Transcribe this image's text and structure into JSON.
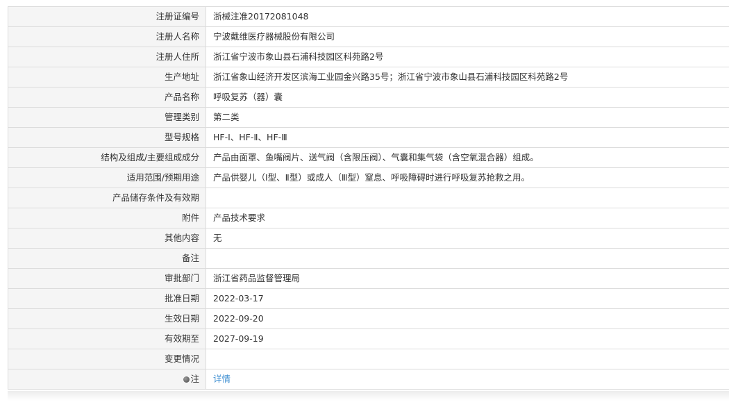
{
  "rows": [
    {
      "label": "注册证编号",
      "value": "浙械注准20172081048"
    },
    {
      "label": "注册人名称",
      "value": "宁波戴维医疗器械股份有限公司"
    },
    {
      "label": "注册人住所",
      "value": "浙江省宁波市象山县石浦科技园区科苑路2号"
    },
    {
      "label": "生产地址",
      "value": "浙江省象山经济开发区滨海工业园金兴路35号；浙江省宁波市象山县石浦科技园区科苑路2号"
    },
    {
      "label": "产品名称",
      "value": "呼吸复苏（器）囊"
    },
    {
      "label": "管理类别",
      "value": "第二类"
    },
    {
      "label": "型号规格",
      "value": "HF-Ⅰ、HF-Ⅱ、HF-Ⅲ"
    },
    {
      "label": "结构及组成/主要组成成分",
      "value": "产品由面罩、鱼嘴阀片、送气阀（含限压阀）、气囊和集气袋（含空氧混合器）组成。"
    },
    {
      "label": "适用范围/预期用途",
      "value": "产品供婴儿（Ⅰ型、Ⅱ型）或成人（Ⅲ型）窒息、呼吸障碍时进行呼吸复苏抢救之用。"
    },
    {
      "label": "产品储存条件及有效期",
      "value": ""
    },
    {
      "label": "附件",
      "value": "产品技术要求"
    },
    {
      "label": "其他内容",
      "value": "无"
    },
    {
      "label": "备注",
      "value": ""
    },
    {
      "label": "审批部门",
      "value": "浙江省药品监督管理局"
    },
    {
      "label": "批准日期",
      "value": "2022-03-17"
    },
    {
      "label": "生效日期",
      "value": "2022-09-20"
    },
    {
      "label": "有效期至",
      "value": "2027-09-19"
    },
    {
      "label": "变更情况",
      "value": ""
    }
  ],
  "note_row": {
    "icon": "bubble-icon",
    "label": "注",
    "link_text": "详情",
    "link_color": "#3f8fd2"
  }
}
